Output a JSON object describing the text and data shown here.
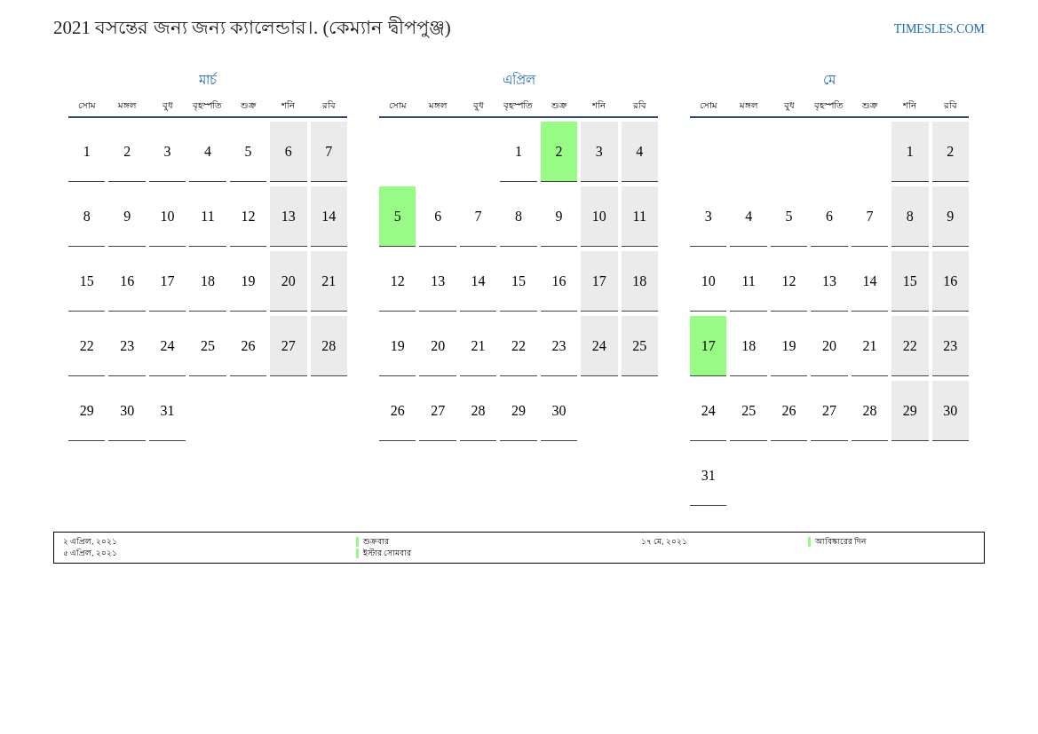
{
  "title": "2021 বসন্তের জন্য জন্য ক্যালেন্ডার।. (কেম্যান দ্বীপপুঞ্জ)",
  "site": "TIMESLES.COM",
  "months": [
    {
      "name": "মার্চ",
      "weekdays": [
        "সোম",
        "মঙ্গল",
        "বুধ",
        "বৃহস্পতি",
        "শুক্র",
        "শনি",
        "রবি"
      ],
      "weeks": [
        {
          "pad_before": false,
          "days": [
            {
              "day": "1",
              "weekend": false,
              "holiday": false
            },
            {
              "day": "2",
              "weekend": false,
              "holiday": false
            },
            {
              "day": "3",
              "weekend": false,
              "holiday": false
            },
            {
              "day": "4",
              "weekend": false,
              "holiday": false
            },
            {
              "day": "5",
              "weekend": false,
              "holiday": false
            },
            {
              "day": "6",
              "weekend": true,
              "holiday": false
            },
            {
              "day": "7",
              "weekend": true,
              "holiday": false
            }
          ]
        },
        {
          "pad_before": false,
          "days": [
            {
              "day": "8",
              "weekend": false,
              "holiday": false
            },
            {
              "day": "9",
              "weekend": false,
              "holiday": false
            },
            {
              "day": "10",
              "weekend": false,
              "holiday": false
            },
            {
              "day": "11",
              "weekend": false,
              "holiday": false
            },
            {
              "day": "12",
              "weekend": false,
              "holiday": false
            },
            {
              "day": "13",
              "weekend": true,
              "holiday": false
            },
            {
              "day": "14",
              "weekend": true,
              "holiday": false
            }
          ]
        },
        {
          "pad_before": false,
          "days": [
            {
              "day": "15",
              "weekend": false,
              "holiday": false
            },
            {
              "day": "16",
              "weekend": false,
              "holiday": false
            },
            {
              "day": "17",
              "weekend": false,
              "holiday": false
            },
            {
              "day": "18",
              "weekend": false,
              "holiday": false
            },
            {
              "day": "19",
              "weekend": false,
              "holiday": false
            },
            {
              "day": "20",
              "weekend": true,
              "holiday": false
            },
            {
              "day": "21",
              "weekend": true,
              "holiday": false
            }
          ]
        },
        {
          "pad_before": false,
          "days": [
            {
              "day": "22",
              "weekend": false,
              "holiday": false
            },
            {
              "day": "23",
              "weekend": false,
              "holiday": false
            },
            {
              "day": "24",
              "weekend": false,
              "holiday": false
            },
            {
              "day": "25",
              "weekend": false,
              "holiday": false
            },
            {
              "day": "26",
              "weekend": false,
              "holiday": false
            },
            {
              "day": "27",
              "weekend": true,
              "holiday": false
            },
            {
              "day": "28",
              "weekend": true,
              "holiday": false
            }
          ]
        },
        {
          "pad_before": false,
          "days": [
            {
              "day": "29",
              "weekend": false,
              "holiday": false
            },
            {
              "day": "30",
              "weekend": false,
              "holiday": false
            },
            {
              "day": "31",
              "weekend": false,
              "holiday": false
            }
          ]
        }
      ]
    },
    {
      "name": "এপ্রিল",
      "weekdays": [
        "সোম",
        "মঙ্গল",
        "বুধ",
        "বৃহস্পতি",
        "শুক্র",
        "শনি",
        "রবি"
      ],
      "weeks": [
        {
          "pad_before": true,
          "days": [
            {
              "day": "1",
              "weekend": false,
              "holiday": false
            },
            {
              "day": "2",
              "holiday": true
            },
            {
              "day": "3",
              "weekend": true,
              "holiday": false
            },
            {
              "day": "4",
              "weekend": true,
              "holiday": false
            }
          ]
        },
        {
          "pad_before": false,
          "days": [
            {
              "day": "5",
              "holiday": true
            },
            {
              "day": "6",
              "weekend": false,
              "holiday": false
            },
            {
              "day": "7",
              "weekend": false,
              "holiday": false
            },
            {
              "day": "8",
              "weekend": false,
              "holiday": false
            },
            {
              "day": "9",
              "weekend": false,
              "holiday": false
            },
            {
              "day": "10",
              "weekend": true,
              "holiday": false
            },
            {
              "day": "11",
              "weekend": true,
              "holiday": false
            }
          ]
        },
        {
          "pad_before": false,
          "days": [
            {
              "day": "12",
              "weekend": false,
              "holiday": false
            },
            {
              "day": "13",
              "weekend": false,
              "holiday": false
            },
            {
              "day": "14",
              "weekend": false,
              "holiday": false
            },
            {
              "day": "15",
              "weekend": false,
              "holiday": false
            },
            {
              "day": "16",
              "weekend": false,
              "holiday": false
            },
            {
              "day": "17",
              "weekend": true,
              "holiday": false
            },
            {
              "day": "18",
              "weekend": true,
              "holiday": false
            }
          ]
        },
        {
          "pad_before": false,
          "days": [
            {
              "day": "19",
              "weekend": false,
              "holiday": false
            },
            {
              "day": "20",
              "weekend": false,
              "holiday": false
            },
            {
              "day": "21",
              "weekend": false,
              "holiday": false
            },
            {
              "day": "22",
              "weekend": false,
              "holiday": false
            },
            {
              "day": "23",
              "weekend": false,
              "holiday": false
            },
            {
              "day": "24",
              "weekend": true,
              "holiday": false
            },
            {
              "day": "25",
              "weekend": true,
              "holiday": false
            }
          ]
        },
        {
          "pad_before": false,
          "days": [
            {
              "day": "26",
              "weekend": false,
              "holiday": false
            },
            {
              "day": "27",
              "weekend": false,
              "holiday": false
            },
            {
              "day": "28",
              "weekend": false,
              "holiday": false
            },
            {
              "day": "29",
              "weekend": false,
              "holiday": false
            },
            {
              "day": "30",
              "weekend": false,
              "holiday": false
            }
          ]
        }
      ]
    },
    {
      "name": "মে",
      "weekdays": [
        "সোম",
        "মঙ্গল",
        "বুধ",
        "বৃহস্পতি",
        "শুক্র",
        "শনি",
        "রবি"
      ],
      "weeks": [
        {
          "pad_before": true,
          "days": [
            {
              "day": "1",
              "weekend": true,
              "holiday": false
            },
            {
              "day": "2",
              "weekend": true,
              "holiday": false
            }
          ]
        },
        {
          "pad_before": false,
          "days": [
            {
              "day": "3",
              "weekend": false,
              "holiday": false
            },
            {
              "day": "4",
              "weekend": false,
              "holiday": false
            },
            {
              "day": "5",
              "weekend": false,
              "holiday": false
            },
            {
              "day": "6",
              "weekend": false,
              "holiday": false
            },
            {
              "day": "7",
              "weekend": false,
              "holiday": false
            },
            {
              "day": "8",
              "weekend": true,
              "holiday": false
            },
            {
              "day": "9",
              "weekend": true,
              "holiday": false
            }
          ]
        },
        {
          "pad_before": false,
          "days": [
            {
              "day": "10",
              "weekend": false,
              "holiday": false
            },
            {
              "day": "11",
              "weekend": false,
              "holiday": false
            },
            {
              "day": "12",
              "weekend": false,
              "holiday": false
            },
            {
              "day": "13",
              "weekend": false,
              "holiday": false
            },
            {
              "day": "14",
              "weekend": false,
              "holiday": false
            },
            {
              "day": "15",
              "weekend": true,
              "holiday": false
            },
            {
              "day": "16",
              "weekend": true,
              "holiday": false
            }
          ]
        },
        {
          "pad_before": false,
          "days": [
            {
              "day": "17",
              "holiday": true
            },
            {
              "day": "18",
              "weekend": false,
              "holiday": false
            },
            {
              "day": "19",
              "weekend": false,
              "holiday": false
            },
            {
              "day": "20",
              "weekend": false,
              "holiday": false
            },
            {
              "day": "21",
              "weekend": false,
              "holiday": false
            },
            {
              "day": "22",
              "weekend": true,
              "holiday": false
            },
            {
              "day": "23",
              "weekend": true,
              "holiday": false
            }
          ]
        },
        {
          "pad_before": false,
          "days": [
            {
              "day": "24",
              "weekend": false,
              "holiday": false
            },
            {
              "day": "25",
              "weekend": false,
              "holiday": false
            },
            {
              "day": "26",
              "weekend": false,
              "holiday": false
            },
            {
              "day": "27",
              "weekend": false,
              "holiday": false
            },
            {
              "day": "28",
              "weekend": false,
              "holiday": false
            },
            {
              "day": "29",
              "weekend": true,
              "holiday": false
            },
            {
              "day": "30",
              "weekend": true,
              "holiday": false
            }
          ]
        },
        {
          "pad_before": false,
          "days": [
            {
              "day": "31",
              "weekend": false,
              "holiday": false
            }
          ]
        }
      ]
    }
  ],
  "holiday_columns": [
    [
      {
        "date": "২ এপ্রিল, ২০২১",
        "name": "শুক্রবার"
      },
      {
        "date": "৫ এপ্রিল, ২০২১",
        "name": "ইস্টার সোমবার"
      }
    ],
    [
      {
        "date": "১৭ মে, ২০২১",
        "name": "আবিষ্কারের দিন"
      }
    ]
  ]
}
